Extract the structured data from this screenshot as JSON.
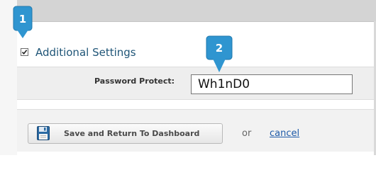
{
  "settings": {
    "title": "Additional Settings",
    "checked": true
  },
  "password": {
    "label": "Password Protect:",
    "value": "Wh1nD0"
  },
  "actions": {
    "save_label": "Save and Return To Dashboard",
    "save_icon": "floppy-disk-icon",
    "or_text": "or",
    "cancel_label": "cancel"
  },
  "markers": [
    {
      "label": "1"
    },
    {
      "label": "2"
    }
  ],
  "colors": {
    "accent": "#2f95d0",
    "heading": "#1f5577",
    "link": "#1e5aa8"
  }
}
